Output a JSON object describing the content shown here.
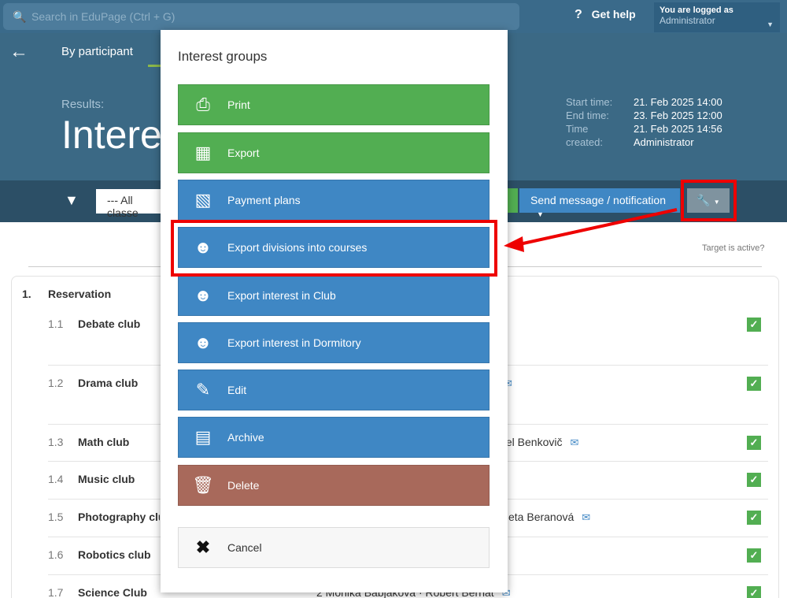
{
  "topbar": {
    "search_placeholder": "Search in EduPage (Ctrl + G)",
    "help": "Get help",
    "user_line1": "You are logged as",
    "user_line2": "Administrator"
  },
  "header": {
    "tab": "By participant",
    "results_label": "Results:",
    "title": "Intere",
    "meta": [
      {
        "k": "Start time:",
        "v": "21. Feb 2025 14:00"
      },
      {
        "k": "End time:",
        "v": "23. Feb 2025 12:00"
      },
      {
        "k": "Time",
        "v": "21. Feb 2025 14:56"
      },
      {
        "k": "created:",
        "v": "Administrator"
      }
    ]
  },
  "filterbar": {
    "class_select": "--- All classe",
    "send": "Send message / notification"
  },
  "content": {
    "target": "Target is active?",
    "section_num": "1.",
    "section_title": "Reservation",
    "rows": [
      {
        "num": "1.1",
        "name": "Debate club",
        "teacher": ""
      },
      {
        "num": "1.2",
        "name": "Drama club",
        "teacher": ""
      },
      {
        "num": "1.3",
        "name": "Math club",
        "teacher": "niel Benkovič"
      },
      {
        "num": "1.4",
        "name": "Music club",
        "teacher": ""
      },
      {
        "num": "1.5",
        "name": "Photography club",
        "teacher": "eta Beranová"
      },
      {
        "num": "1.6",
        "name": "Robotics club",
        "teacher": ""
      },
      {
        "num": "1.7",
        "name": "Science Club",
        "teacher": "2  Monika Babjaková · Robert Bernat"
      }
    ]
  },
  "modal": {
    "title": "Interest groups",
    "buttons": [
      {
        "label": "Print",
        "icon": "printer-icon"
      },
      {
        "label": "Export",
        "icon": "table-grid-icon"
      },
      {
        "label": "Payment plans",
        "icon": "banknote-icon"
      },
      {
        "label": "Export divisions into courses",
        "icon": "users-group-icon"
      },
      {
        "label": "Export interest in Club",
        "icon": "users-group-icon"
      },
      {
        "label": "Export interest in Dormitory",
        "icon": "users-group-icon"
      },
      {
        "label": "Edit",
        "icon": "pencil-icon"
      },
      {
        "label": "Archive",
        "icon": "archive-box-icon"
      },
      {
        "label": "Delete",
        "icon": "trash-icon"
      },
      {
        "label": "Cancel",
        "icon": "close-x-icon"
      }
    ]
  },
  "colors": {
    "header": "#3b6985",
    "green": "#52ae52",
    "blue": "#3f87c4",
    "delete": "#a8695b",
    "highlight": "#e00000"
  }
}
